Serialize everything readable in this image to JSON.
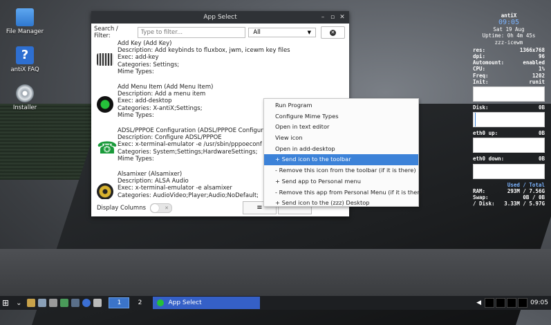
{
  "desktop": {
    "icons": [
      {
        "label": "File Manager",
        "icon": "folder-icon"
      },
      {
        "label": "antiX FAQ",
        "icon": "help-icon"
      },
      {
        "label": "Installer",
        "icon": "installer-disc-icon"
      }
    ]
  },
  "conky": {
    "hostname": "antiX",
    "time": "09:05",
    "date": "Sat 19 Aug",
    "uptime": "Uptime: 0h 4m 45s",
    "wm": "zzz-icewm",
    "stats": [
      {
        "k": "res:",
        "v": "1366x768"
      },
      {
        "k": "dpi:",
        "v": "96"
      },
      {
        "k": "Automount:",
        "v": "enabled"
      },
      {
        "k": "CPU:",
        "v": "1%"
      },
      {
        "k": "Freq:",
        "v": "1202"
      },
      {
        "k": "Init:",
        "v": "runit"
      }
    ],
    "disk_label": "Disk:",
    "disk_value": "0B",
    "eth_up_label": "eth0 up:",
    "eth_up_value": "0B",
    "eth_down_label": "eth0 down:",
    "eth_down_value": "0B",
    "used_total_header": "Used / Total",
    "mem": [
      {
        "k": "RAM:",
        "a": "293M",
        "b": "/ 7.56G"
      },
      {
        "k": "Swap:",
        "a": "0B",
        "b": "/ 0B"
      },
      {
        "k": "/ Disk:",
        "a": "3.33M",
        "b": "/ 5.97G"
      }
    ]
  },
  "window": {
    "title": "App Select",
    "filter_label": "Search / Filter:",
    "filter_placeholder": "Type to filter...",
    "category_value": "All",
    "display_columns_label": "Display Columns",
    "entries": [
      {
        "icon": "keyboard-icon",
        "lines": [
          "Add Key (Add Key)",
          "Description: Add keybinds to fluxbox, jwm, icewm key files",
          "Exec: add-key",
          "Categories: Settings;",
          "Mime Types:"
        ]
      },
      {
        "icon": "green-circle-icon",
        "lines": [
          "Add Menu Item (Add Menu Item)",
          "Description: Add a menu item",
          "Exec: add-desktop",
          "Categories: X-antiX;Settings;",
          "Mime Types:"
        ]
      },
      {
        "icon": "phone-icon",
        "lines": [
          "ADSL/PPPOE Configuration (ADSL/PPPOE Configuration)",
          "Description: Configure ADSL/PPPOE",
          "Exec: x-terminal-emulator -e /usr/sbin/pppoeconf",
          "Categories: System;Settings;HardwareSettings;",
          "Mime Types:"
        ]
      },
      {
        "icon": "speaker-icon",
        "lines": [
          "Alsamixer (Alsamixer)",
          "Description: ALSA Audio",
          "Exec: x-terminal-emulator -e alsamixer",
          "Categories: AudioVideo;Player;Audio;NoDefault;"
        ]
      }
    ]
  },
  "context_menu": {
    "items": [
      "Run Program",
      "Configure Mime Types",
      "Open in text editor",
      "View icon",
      "Open in add-desktop",
      "+ Send icon to the toolbar",
      "- Remove this icon from the toolbar (if it is there)",
      "+ Send app to Personal menu",
      "- Remove this app from Personal Menu (if it is there)",
      "+ Send icon to the (zzz) Desktop"
    ],
    "selected_index": 5
  },
  "taskbar": {
    "workspaces": [
      "1",
      "2"
    ],
    "active_workspace": "1",
    "task_label": "App Select",
    "clock": "09:05"
  },
  "colors": {
    "accent": "#3c82d8",
    "taskbar": "#1d1f22",
    "titlebar": "#2f3236"
  }
}
